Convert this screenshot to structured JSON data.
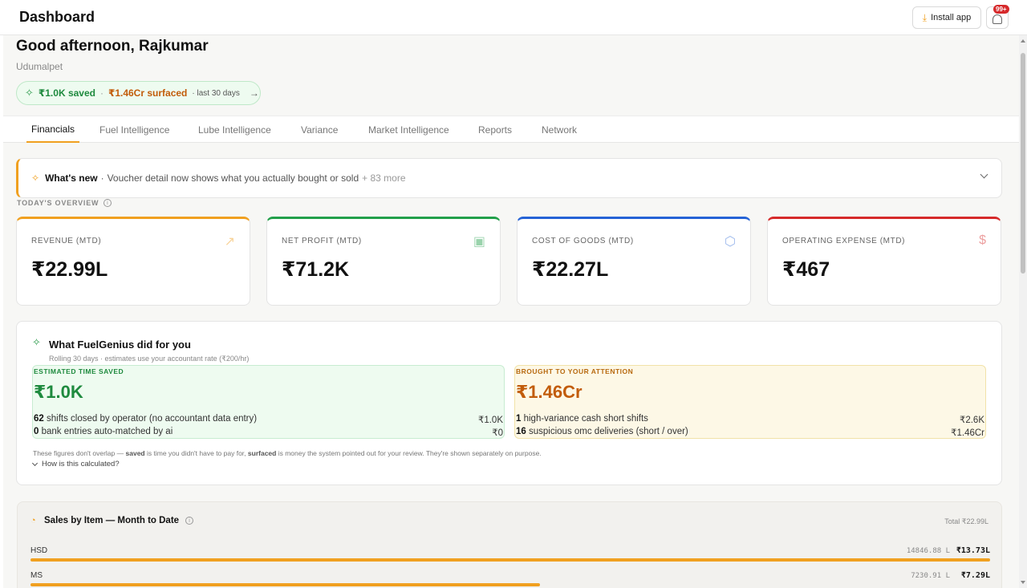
{
  "header": {
    "title": "Dashboard",
    "install_label": "Install app",
    "notification_badge": "99+"
  },
  "greeting": "Good afternoon, Rajkumar",
  "location": "Udumalpet",
  "savings_pill": {
    "saved": "₹1.0K saved",
    "dot": "·",
    "surfaced": "₹1.46Cr surfaced",
    "period": "· last 30 days",
    "arrow": "→"
  },
  "tabs": [
    {
      "label": "Financials",
      "active": true
    },
    {
      "label": "Fuel Intelligence",
      "active": false
    },
    {
      "label": "Lube Intelligence",
      "active": false
    },
    {
      "label": "Variance",
      "active": false
    },
    {
      "label": "Market Intelligence",
      "active": false
    },
    {
      "label": "Reports",
      "active": false
    },
    {
      "label": "Network",
      "active": false
    }
  ],
  "whats_new": {
    "head": "What's new",
    "sep": "·",
    "message": "Voucher detail now shows what you actually bought or sold",
    "more": "+ 83 more"
  },
  "overview_label": "TODAY'S OVERVIEW",
  "kpis": [
    {
      "label": "REVENUE (MTD)",
      "value": "₹22.99L",
      "color": "#f0a020",
      "icon": "trending-up-icon"
    },
    {
      "label": "NET PROFIT (MTD)",
      "value": "₹71.2K",
      "color": "#22a04a",
      "icon": "wallet-icon"
    },
    {
      "label": "COST OF GOODS (MTD)",
      "value": "₹22.27L",
      "color": "#2563d6",
      "icon": "box-icon"
    },
    {
      "label": "OPERATING EXPENSE (MTD)",
      "value": "₹467",
      "color": "#d62a2a",
      "icon": "receipt-icon"
    }
  ],
  "fuelgenius": {
    "title": "What FuelGenius did for you",
    "subtitle": "Rolling 30 days · estimates use your accountant rate (₹200/hr)",
    "saved": {
      "label": "ESTIMATED TIME SAVED",
      "value": "₹1.0K",
      "rows": [
        {
          "count": "62",
          "text": "shifts closed by operator (no accountant data entry)",
          "amount": "₹1.0K"
        },
        {
          "count": "0",
          "text": "bank entries auto-matched by ai",
          "amount": "₹0"
        }
      ]
    },
    "attention": {
      "label": "BROUGHT TO YOUR ATTENTION",
      "value": "₹1.46Cr",
      "rows": [
        {
          "count": "1",
          "text": "high-variance cash short shifts",
          "amount": "₹2.6K"
        },
        {
          "count": "16",
          "text": "suspicious omc deliveries (short / over)",
          "amount": "₹1.46Cr"
        }
      ]
    },
    "note_pre": "These figures don't overlap —",
    "note_saved": "saved",
    "note_mid": "is time you didn't have to pay for,",
    "note_surfaced": "surfaced",
    "note_post": "is money the system pointed out for your review. They're shown separately on purpose.",
    "how_label": "How is this calculated?"
  },
  "sales": {
    "title": "Sales by Item — Month to Date",
    "total": "Total ₹22.99L",
    "items": [
      {
        "name": "HSD",
        "qty": "14846.88 L",
        "amount": "₹13.73L",
        "share": 1.0
      },
      {
        "name": "MS",
        "qty": "7230.91 L",
        "amount": "₹7.29L",
        "share": 0.531
      }
    ]
  }
}
